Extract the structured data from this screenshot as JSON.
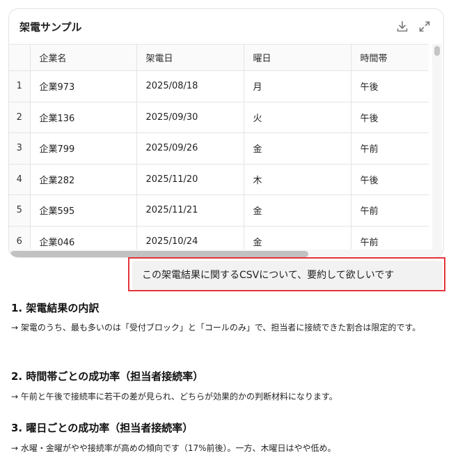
{
  "card": {
    "title": "架電サンプル",
    "icons": {
      "download": "download-icon",
      "expand": "expand-icon"
    }
  },
  "table": {
    "columns": [
      "企業名",
      "架電日",
      "曜日",
      "時間帯"
    ],
    "rows": [
      {
        "index": "1",
        "company": "企業973",
        "date": "2025/08/18",
        "weekday": "月",
        "timeslot": "午後"
      },
      {
        "index": "2",
        "company": "企業136",
        "date": "2025/09/30",
        "weekday": "火",
        "timeslot": "午後"
      },
      {
        "index": "3",
        "company": "企業799",
        "date": "2025/09/26",
        "weekday": "金",
        "timeslot": "午前"
      },
      {
        "index": "4",
        "company": "企業282",
        "date": "2025/11/20",
        "weekday": "木",
        "timeslot": "午後"
      },
      {
        "index": "5",
        "company": "企業595",
        "date": "2025/11/21",
        "weekday": "金",
        "timeslot": "午前"
      },
      {
        "index": "6",
        "company": "企業046",
        "date": "2025/10/24",
        "weekday": "金",
        "timeslot": "午前"
      }
    ]
  },
  "user_message": "この架電結果に関するCSVについて、要約して欲しいです",
  "colors": {
    "highlight": "#e3343b",
    "bubble": "#f2f2f2"
  },
  "sections": [
    {
      "title": "1. 架電結果の内訳",
      "body": "→ 架電のうち、最も多いのは「受付ブロック」と「コールのみ」で、担当者に接続できた割合は限定的です。"
    },
    {
      "title": "2. 時間帯ごとの成功率（担当者接続率）",
      "body": "→ 午前と午後で接続率に若干の差が見られ、どちらが効果的かの判断材料になります。"
    },
    {
      "title": "3. 曜日ごとの成功率（担当者接続率）",
      "body": "→ 水曜・金曜がやや接続率が高めの傾向です（17%前後）。一方、木曜日はやや低め。"
    }
  ]
}
